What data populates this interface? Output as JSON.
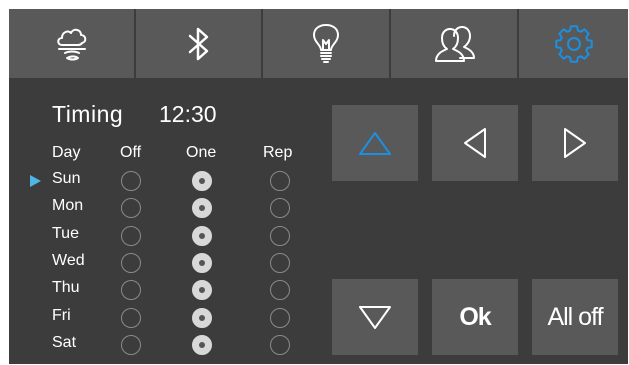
{
  "colors": {
    "accent": "#1c8fe0",
    "cursor": "#4fb5e6",
    "panel": "#3c3c3c",
    "tile": "#595959",
    "icon": "#ffffff"
  },
  "tabs": [
    {
      "icon": "weather-cloud-icon"
    },
    {
      "icon": "bluetooth-icon"
    },
    {
      "icon": "light-bulb-icon"
    },
    {
      "icon": "users-icon"
    },
    {
      "icon": "gear-icon",
      "active": true
    }
  ],
  "timing": {
    "title": "Timing",
    "time": "12:30"
  },
  "table": {
    "headers": {
      "day": "Day",
      "off": "Off",
      "one": "One",
      "rep": "Rep"
    },
    "selected_day": "Sun",
    "rows": [
      {
        "day": "Sun",
        "mode": "One"
      },
      {
        "day": "Mon",
        "mode": "One"
      },
      {
        "day": "Tue",
        "mode": "One"
      },
      {
        "day": "Wed",
        "mode": "One"
      },
      {
        "day": "Thu",
        "mode": "One"
      },
      {
        "day": "Fri",
        "mode": "One"
      },
      {
        "day": "Sat",
        "mode": "One"
      }
    ]
  },
  "controls": {
    "up": {
      "icon": "triangle-up-icon",
      "active": true
    },
    "left": {
      "icon": "triangle-left-icon"
    },
    "right": {
      "icon": "triangle-right-icon"
    },
    "down": {
      "icon": "triangle-down-icon"
    },
    "ok_label": "Ok",
    "all_off_label": "All off"
  }
}
